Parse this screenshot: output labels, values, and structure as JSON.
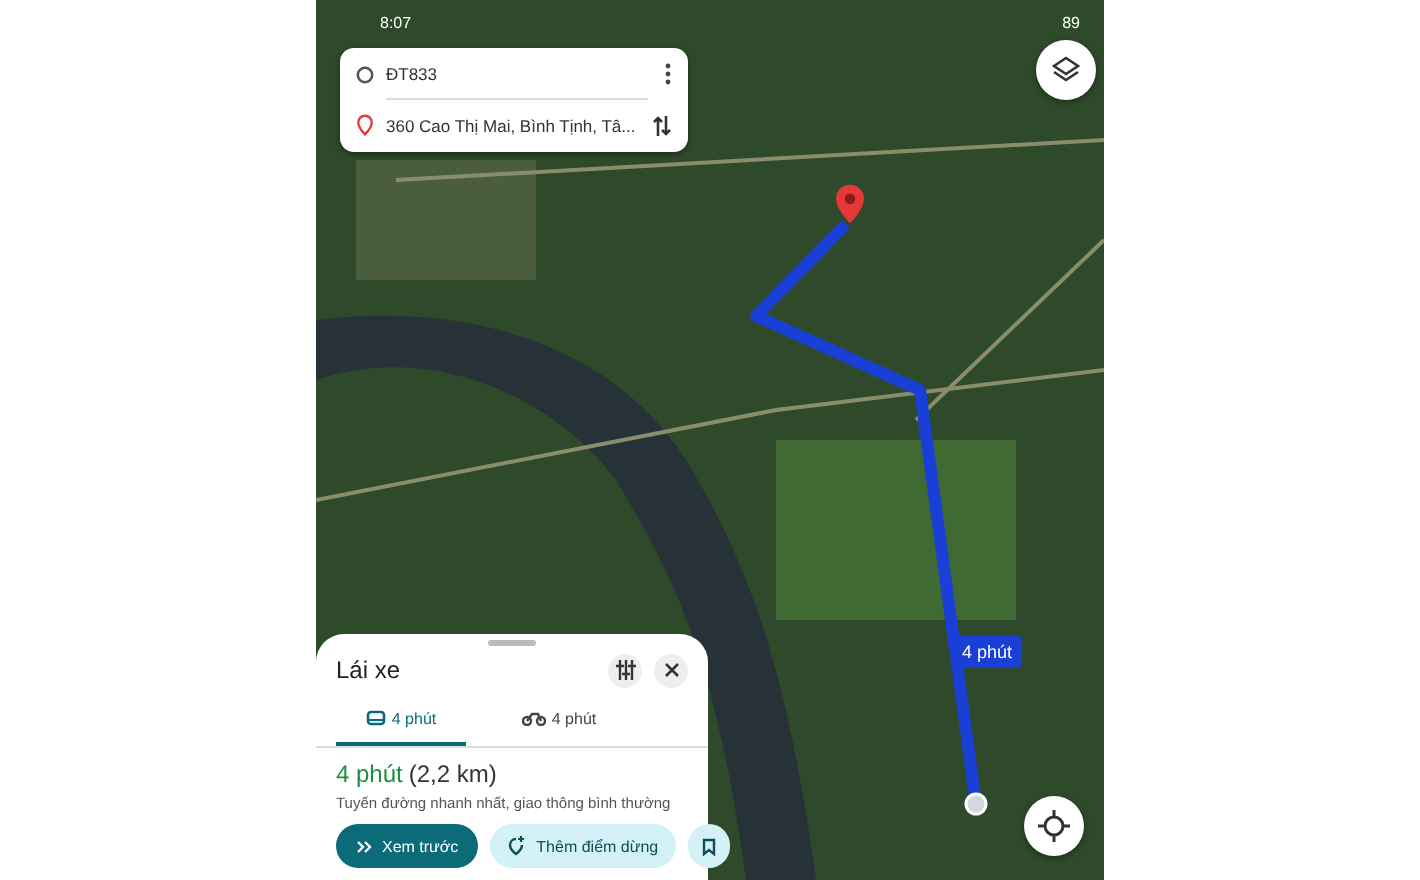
{
  "status_bar": {
    "time": "8:07",
    "battery": "89"
  },
  "directions": {
    "origin": "ĐT833",
    "destination": "360 Cao Thị Mai, Bình Tịnh, Tâ..."
  },
  "route_badge": "4 phút",
  "sheet": {
    "title": "Lái xe",
    "tabs": [
      {
        "kind": "car",
        "label": "4 phút",
        "selected": true
      },
      {
        "kind": "motorbike",
        "label": "4 phút",
        "selected": false
      }
    ],
    "duration": "4 phút",
    "distance": "(2,2 km)",
    "summary": "Tuyến đường nhanh nhất, giao thông bình thường",
    "buttons": [
      {
        "kind": "primary",
        "label": "Xem trước"
      },
      {
        "kind": "stop",
        "label": "Thêm điểm dừng"
      },
      {
        "kind": "save"
      }
    ]
  }
}
